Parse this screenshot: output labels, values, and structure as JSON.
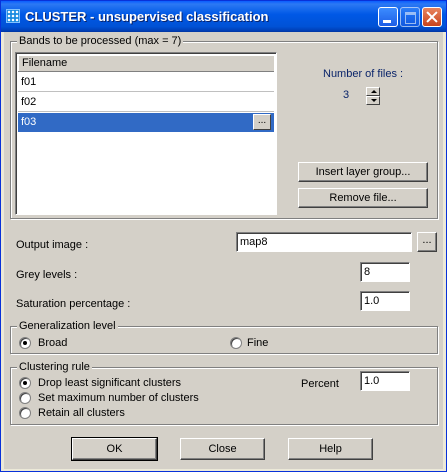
{
  "window": {
    "title": "CLUSTER - unsupervised classification"
  },
  "bands": {
    "group_label": "Bands to be processed (max = 7)",
    "column_header": "Filename",
    "files": [
      {
        "name": "f01",
        "selected": false
      },
      {
        "name": "f02",
        "selected": false
      },
      {
        "name": "f03",
        "selected": true
      }
    ],
    "browse_label": "...",
    "number_of_files_label": "Number of files :",
    "number_of_files_value": "3",
    "insert_layer_group_label": "Insert layer group...",
    "remove_file_label": "Remove file..."
  },
  "output": {
    "label": "Output image :",
    "value": "map8",
    "browse_label": "..."
  },
  "grey_levels": {
    "label": "Grey levels :",
    "value": "8"
  },
  "saturation": {
    "label": "Saturation percentage  :",
    "value": "1.0"
  },
  "generalization": {
    "group_label": "Generalization level",
    "options": [
      {
        "label": "Broad",
        "checked": true
      },
      {
        "label": "Fine",
        "checked": false
      }
    ]
  },
  "clustering": {
    "group_label": "Clustering rule",
    "options": [
      {
        "label": "Drop least significant clusters",
        "checked": true
      },
      {
        "label": "Set maximum number of clusters",
        "checked": false
      },
      {
        "label": "Retain all clusters",
        "checked": false
      }
    ],
    "percent_label": "Percent",
    "percent_value": "1.0"
  },
  "buttons": {
    "ok": "OK",
    "close": "Close",
    "help": "Help"
  },
  "colors": {
    "title_bar": "#0058e6",
    "selection": "#316ac5",
    "face": "#d4d0c8",
    "accent_text": "#0a246a"
  },
  "icons": {
    "app": "cluster-app-icon",
    "minimize": "minimize-icon",
    "maximize": "maximize-icon",
    "close": "close-icon"
  }
}
